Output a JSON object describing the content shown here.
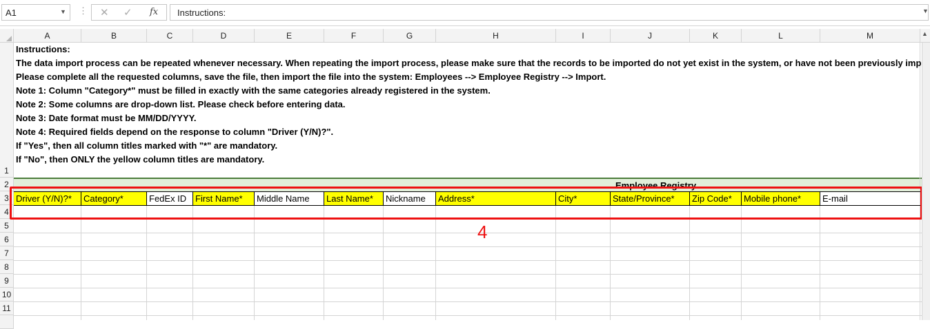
{
  "formula_bar": {
    "name_box": "A1",
    "formula": "Instructions:",
    "cancel_icon": "x-icon",
    "enter_icon": "check-icon",
    "function_icon": "fx-icon"
  },
  "columns": [
    "A",
    "B",
    "C",
    "D",
    "E",
    "F",
    "G",
    "H",
    "I",
    "J",
    "K",
    "L",
    "M"
  ],
  "rows": [
    "1",
    "2",
    "3",
    "4",
    "5",
    "6",
    "7",
    "8",
    "9",
    "10",
    "11"
  ],
  "instructions": [
    "Instructions:",
    "The data import process can be repeated whenever necessary. When repeating the import process, please make sure that the records to be imported do not yet exist in the system, or have not been previously imp",
    "Please complete all the requested columns, save the file, then import the file into the system: Employees --> Employee Registry --> Import.",
    "Note 1: Column \"Category*\" must be filled in exactly with the same categories already registered in the system.",
    "Note 2: Some columns are drop-down list. Please check before entering data.",
    "Note 3: Date format must be MM/DD/YYYY.",
    "Note 4: Required fields depend on the response to column \"Driver (Y/N)?\".",
    "If \"Yes\", then all column titles marked with \"*\" are mandatory.",
    "If \"No\", then ONLY the yellow column titles are mandatory."
  ],
  "section_title": "Employee Registry",
  "headers": [
    {
      "label": "Driver (Y/N)?*",
      "required": true
    },
    {
      "label": "Category*",
      "required": true
    },
    {
      "label": "FedEx ID",
      "required": false
    },
    {
      "label": "First Name*",
      "required": true
    },
    {
      "label": "Middle Name",
      "required": false
    },
    {
      "label": "Last Name*",
      "required": true
    },
    {
      "label": "Nickname",
      "required": false
    },
    {
      "label": "Address*",
      "required": true
    },
    {
      "label": "City*",
      "required": true
    },
    {
      "label": "State/Province*",
      "required": true
    },
    {
      "label": "Zip Code*",
      "required": true
    },
    {
      "label": "Mobile phone*",
      "required": true
    },
    {
      "label": "E-mail",
      "required": false
    }
  ],
  "annotation": {
    "label": "4",
    "color": "#ee1111"
  },
  "colors": {
    "required_fill": "#ffff00",
    "section_band": "#e2efda",
    "highlight": "#ee1111"
  }
}
